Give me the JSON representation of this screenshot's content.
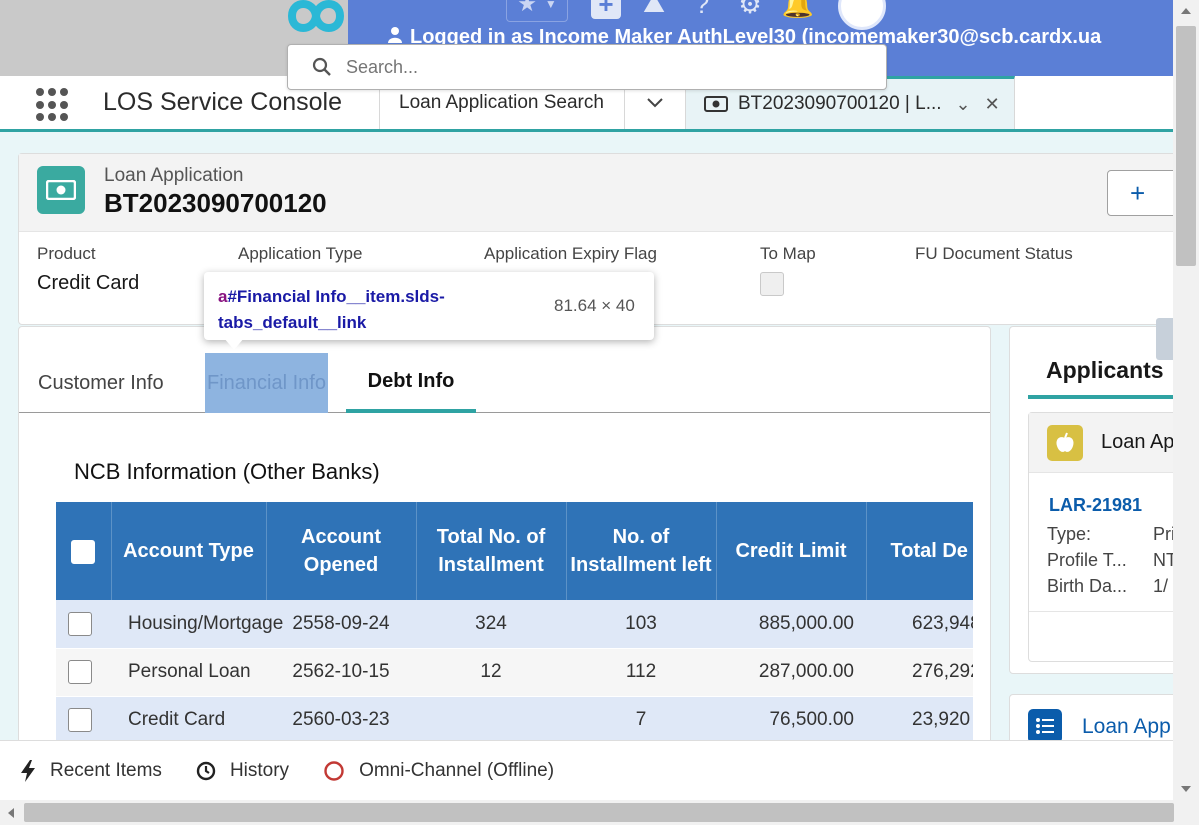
{
  "banner": {
    "login_text": "Logged in as Income Maker AuthLevel30 (incomemaker30@scb.cardx.ua",
    "bg_color": "#5b7fd6"
  },
  "search": {
    "placeholder": "Search..."
  },
  "appnav": {
    "app_name": "LOS Service Console",
    "tabs": [
      {
        "label": "Loan Application Search"
      },
      {
        "label": "BT2023090700120 | L..."
      }
    ]
  },
  "record": {
    "type_label": "Loan Application",
    "name": "BT2023090700120",
    "fields": [
      {
        "label": "Product",
        "value": "Credit Card"
      },
      {
        "label": "Application Type",
        "value": ""
      },
      {
        "label": "Application Expiry Flag",
        "value": ""
      },
      {
        "label": "To Map",
        "value": ""
      },
      {
        "label": "FU Document Status",
        "value": ""
      }
    ]
  },
  "tabs": {
    "items": [
      "Customer Info",
      "Financial Info",
      "Debt Info"
    ],
    "active": "Debt Info"
  },
  "ncb": {
    "title": "NCB Information (Other Banks)",
    "columns": [
      "Account Type",
      "Account Opened",
      "Total No. of Installment",
      "No. of Installment left",
      "Credit Limit",
      "Total De"
    ],
    "rows": [
      [
        "Housing/Mortgage",
        "2558-09-24",
        "324",
        "103",
        "885,000.00",
        "623,948"
      ],
      [
        "Personal Loan",
        "2562-10-15",
        "12",
        "112",
        "287,000.00",
        "276,292"
      ],
      [
        "Credit Card",
        "2560-03-23",
        "",
        "7",
        "76,500.00",
        "23,920"
      ]
    ]
  },
  "applicants": {
    "title": "Applicants",
    "card_title": "Loan Ap",
    "id": "LAR-21981",
    "details": [
      {
        "key": "Type:",
        "value": "Pri"
      },
      {
        "key": "Profile T...",
        "value": "NT"
      },
      {
        "key": "Birth Da...",
        "value": "1/"
      }
    ]
  },
  "loanapp_card": {
    "title": "Loan App"
  },
  "tooltip": {
    "selector_tag": "a",
    "selector_rest": "#Financial Info__item.slds-tabs_default__link",
    "dimensions": "81.64 × 40"
  },
  "utility": {
    "items": [
      "Recent Items",
      "History",
      "Omni-Channel (Offline)"
    ]
  },
  "colors": {
    "accent": "#2fa3a3",
    "table_header": "#2f73b7",
    "link": "#0b5cab",
    "omni_offline": "#c23934"
  }
}
